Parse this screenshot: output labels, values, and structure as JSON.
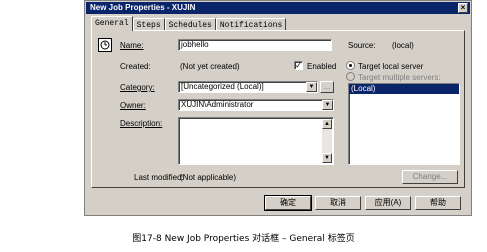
{
  "window": {
    "title": "New Job Properties - XUJIN",
    "close_label": "×"
  },
  "tabs": [
    {
      "label": "General",
      "active": true
    },
    {
      "label": "Steps",
      "active": false
    },
    {
      "label": "Schedules",
      "active": false
    },
    {
      "label": "Notifications",
      "active": false
    }
  ],
  "general": {
    "name_label": "Name:",
    "name_value": "jobhello",
    "source_label": "Source:",
    "source_value": "(local)",
    "created_label": "Created:",
    "created_value": "(Not yet created)",
    "enabled_label": "Enabled",
    "enabled_checked": true,
    "category_label": "Category:",
    "category_value": "[Uncategorized (Local)]",
    "category_browse_label": "...",
    "owner_label": "Owner:",
    "owner_value": "XUJIN\\Administrator",
    "description_label": "Description:",
    "description_value": "",
    "target_local_label": "Target local server",
    "target_multiple_label": "Target multiple servers:",
    "target_list": [
      "(Local)"
    ],
    "last_modified_label": "Last modified:",
    "last_modified_value": "(Not applicable)",
    "change_button": "Change..."
  },
  "footer": {
    "ok": "确定",
    "cancel": "取消",
    "apply": "应用(A)",
    "help": "帮助"
  },
  "caption": "图17-8  New Job Properties 对话框 – General 标签页"
}
